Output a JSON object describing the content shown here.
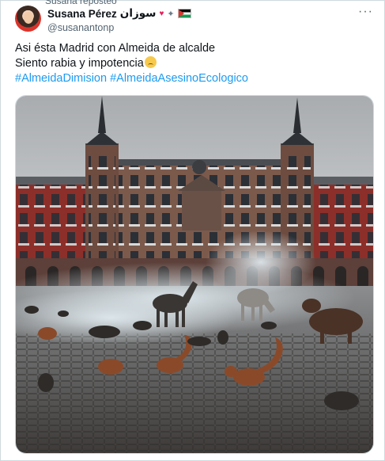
{
  "social_context": "Susana reposteó",
  "author": {
    "name": "Susana Pérez",
    "name_arabic": "سوزان",
    "handle": "@susanantonp",
    "emojis": [
      "heart-icon",
      "peace-dove-icon",
      "palestine-flag-icon"
    ]
  },
  "post": {
    "line1": "Asi ésta Madrid con Almeida de alcalde",
    "line2": "Siento rabia y impotencia",
    "hashtag1": "#AlmeidaDimision",
    "hashtag2": "#AlmeidaAsesinoEcologico"
  },
  "media": {
    "description_icon": "photo-madrid-plaza-mayor-with-animals"
  },
  "colors": {
    "link": "#1d9bf0",
    "secondary_text": "#536471",
    "border": "#cfd9de"
  }
}
